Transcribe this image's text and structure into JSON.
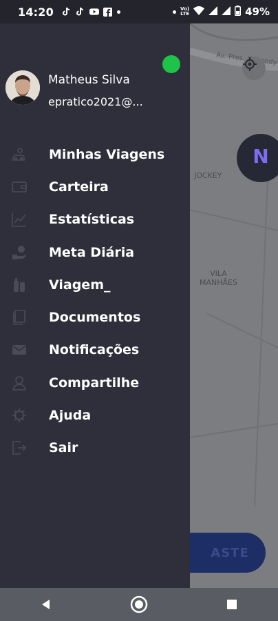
{
  "status_bar": {
    "time": "14:20",
    "battery": "49%",
    "left_icons": [
      "tiktok-icon",
      "tiktok-icon",
      "youtube-icon",
      "facebook-icon"
    ],
    "right_icons": [
      "volte-icon",
      "wifi-icon",
      "signal-icon",
      "signal-icon",
      "battery-icon"
    ]
  },
  "map": {
    "street_label": "Av. Pres. Kennedy",
    "district_1": "JOCKEY",
    "district_2_line1": "VILA",
    "district_2_line2": "MANHÃES",
    "action_button": "ASTE"
  },
  "drawer": {
    "user_name": "Matheus Silva",
    "user_email": "epratico2021@...",
    "online_color": "#1ec34a",
    "menu": [
      {
        "label": "Minhas Viagens",
        "icon": "car-history-icon"
      },
      {
        "label": "Carteira",
        "icon": "wallet-icon"
      },
      {
        "label": "Estatísticas",
        "icon": "chart-icon"
      },
      {
        "label": "Meta Diária",
        "icon": "goal-money-icon"
      },
      {
        "label": "Viagem_",
        "icon": "luggage-icon"
      },
      {
        "label": "Documentos",
        "icon": "documents-icon"
      },
      {
        "label": "Notificações",
        "icon": "envelope-icon"
      },
      {
        "label": "Compartilhe",
        "icon": "share-user-icon"
      },
      {
        "label": "Ajuda",
        "icon": "help-gear-icon"
      },
      {
        "label": "Sair",
        "icon": "logout-icon"
      }
    ]
  },
  "nav_bar": {
    "buttons": [
      "back-icon",
      "home-icon",
      "recents-icon"
    ]
  }
}
